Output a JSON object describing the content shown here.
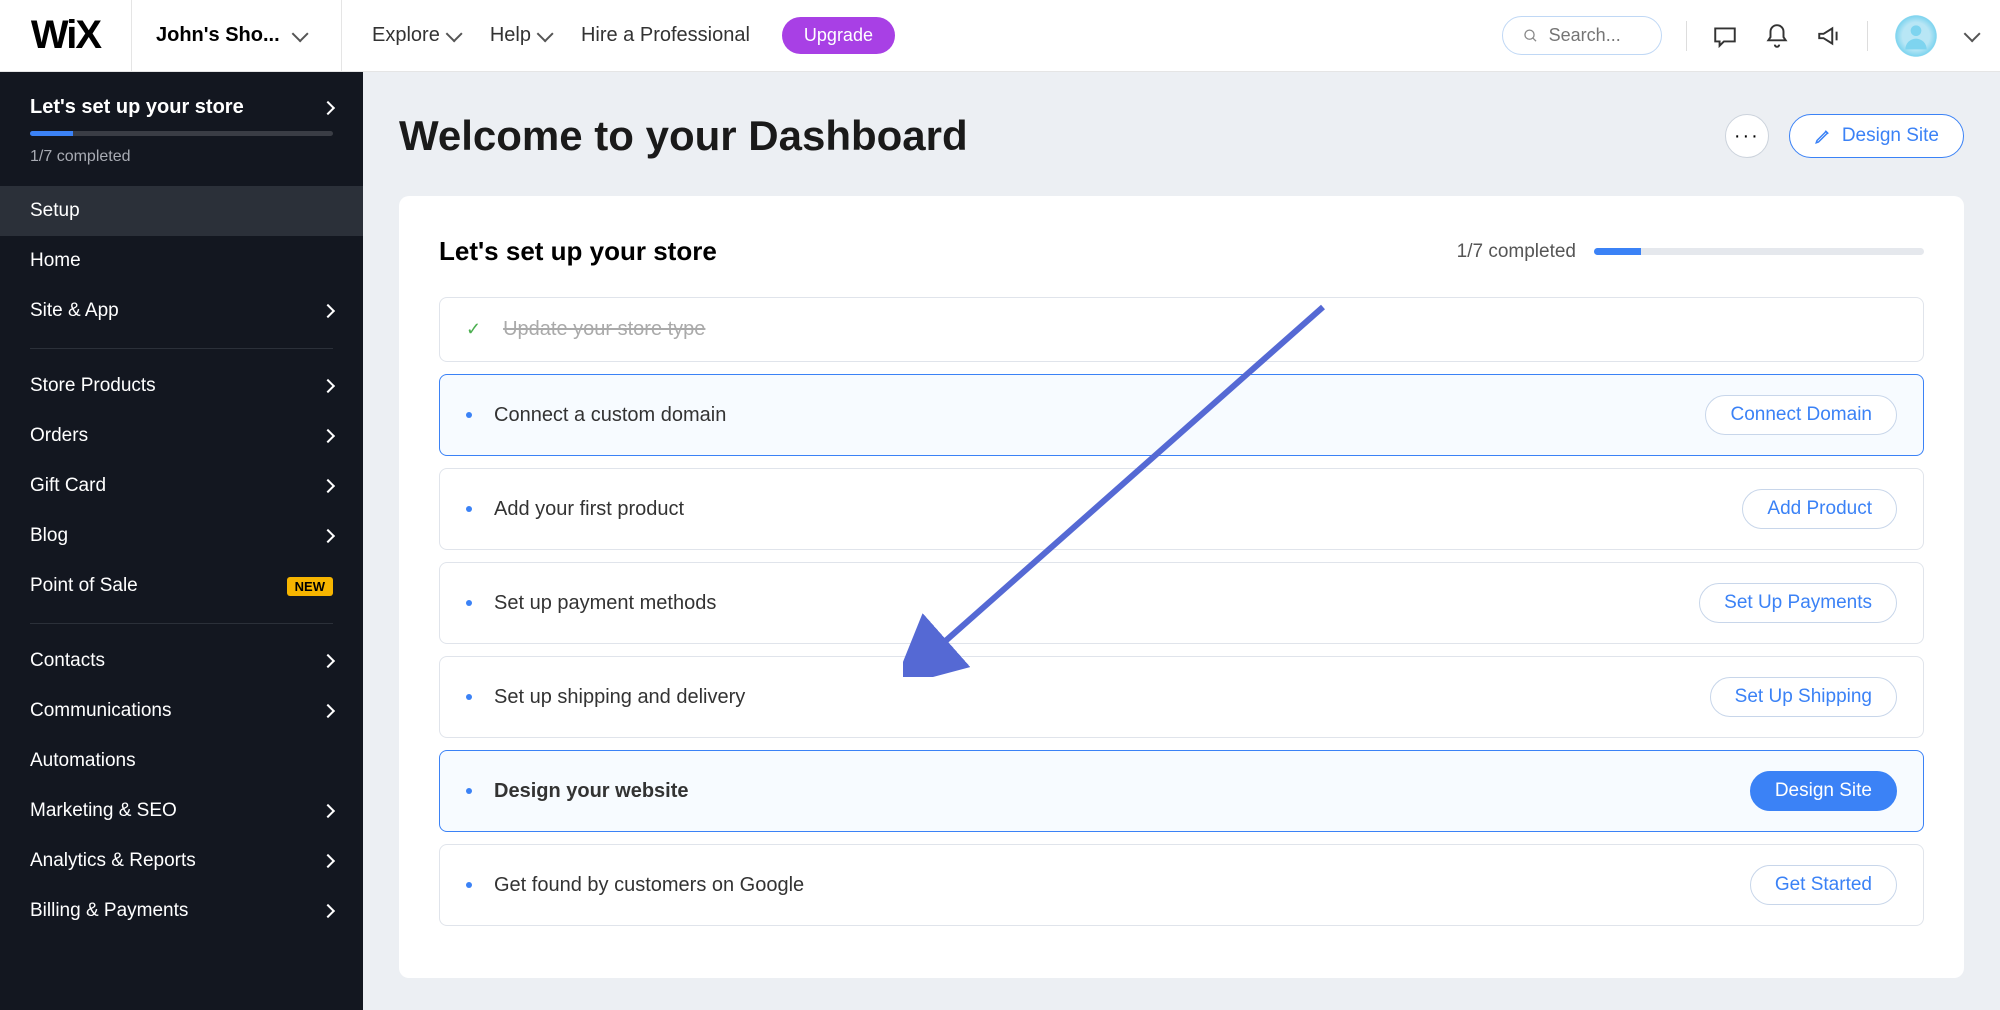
{
  "topbar": {
    "logo": "WiX",
    "site_name": "John's Sho...",
    "nav": {
      "explore": "Explore",
      "help": "Help",
      "hire": "Hire a Professional"
    },
    "upgrade": "Upgrade",
    "search_placeholder": "Search..."
  },
  "sidebar": {
    "header_title": "Let's set up your store",
    "progress_text": "1/7 completed",
    "items": [
      {
        "label": "Setup",
        "has_chevron": false
      },
      {
        "label": "Home",
        "has_chevron": false
      },
      {
        "label": "Site & App",
        "has_chevron": true
      },
      {
        "label": "Store Products",
        "has_chevron": true
      },
      {
        "label": "Orders",
        "has_chevron": true
      },
      {
        "label": "Gift Card",
        "has_chevron": true
      },
      {
        "label": "Blog",
        "has_chevron": true
      },
      {
        "label": "Point of Sale",
        "has_chevron": false,
        "badge": "NEW"
      },
      {
        "label": "Contacts",
        "has_chevron": true
      },
      {
        "label": "Communications",
        "has_chevron": true
      },
      {
        "label": "Automations",
        "has_chevron": false
      },
      {
        "label": "Marketing & SEO",
        "has_chevron": true
      },
      {
        "label": "Analytics & Reports",
        "has_chevron": true
      },
      {
        "label": "Billing & Payments",
        "has_chevron": true
      }
    ]
  },
  "main": {
    "title": "Welcome to your Dashboard",
    "design_site": "Design Site",
    "card": {
      "title": "Let's set up your store",
      "progress_text": "1/7 completed",
      "steps": [
        {
          "label": "Update your store type",
          "completed": true,
          "button": null
        },
        {
          "label": "Connect a custom domain",
          "button": "Connect Domain",
          "highlighted": true
        },
        {
          "label": "Add your first product",
          "button": "Add Product"
        },
        {
          "label": "Set up payment methods",
          "button": "Set Up Payments"
        },
        {
          "label": "Set up shipping and delivery",
          "button": "Set Up Shipping"
        },
        {
          "label": "Design your website",
          "button": "Design Site",
          "highlighted": true,
          "primary": true,
          "bold": true
        },
        {
          "label": "Get found by customers on Google",
          "button": "Get Started"
        }
      ]
    }
  }
}
